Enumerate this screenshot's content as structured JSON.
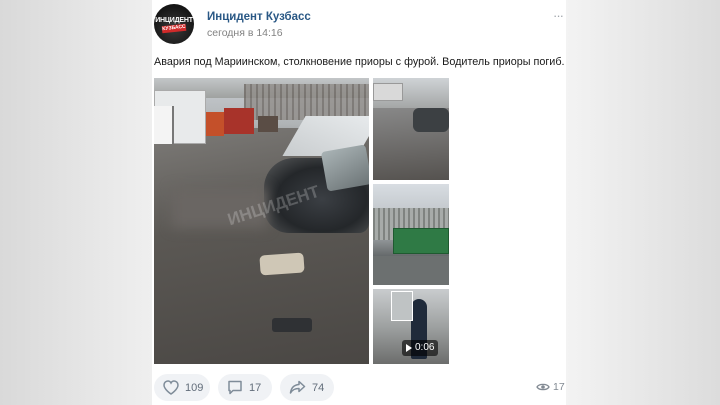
{
  "post": {
    "author": "Инцидент Кузбасс",
    "timestamp": "сегодня в 14:16",
    "text": "Авария под Мариинском, столкновение приоры с фурой. Водитель приоры погиб.",
    "avatar": {
      "line1": "ИНЦИДЕНТ",
      "line2": "КУЗБАСС"
    },
    "more_icon": "more-horizontal-icon",
    "video": {
      "duration": "0:06"
    }
  },
  "watermark": "ИНЦИДЕНТ",
  "actions": {
    "likes": "109",
    "comments": "17",
    "shares": "74",
    "views": "17"
  },
  "colors": {
    "author": "#2a5885",
    "action_bg": "#f0f2f5",
    "muted": "#828282"
  }
}
